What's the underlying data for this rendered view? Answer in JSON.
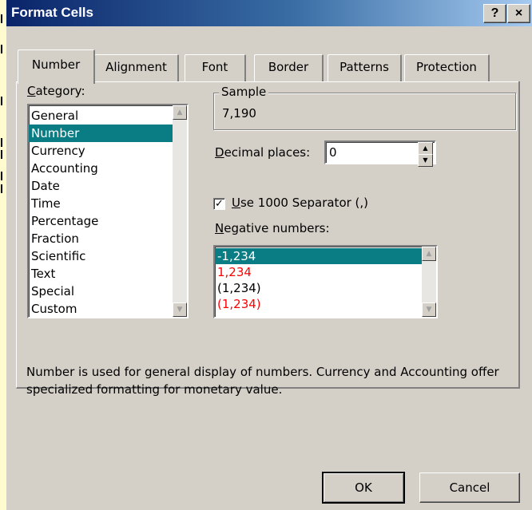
{
  "window": {
    "title": "Format Cells",
    "help_glyph": "?",
    "close_glyph": "×"
  },
  "tabs": [
    {
      "label": "Number",
      "active": true
    },
    {
      "label": "Alignment"
    },
    {
      "label": "Font"
    },
    {
      "label": "Border"
    },
    {
      "label": "Patterns"
    },
    {
      "label": "Protection"
    }
  ],
  "category": {
    "label_u": "C",
    "label_rest": "ategory:",
    "items": [
      "General",
      "Number",
      "Currency",
      "Accounting",
      "Date",
      "Time",
      "Percentage",
      "Fraction",
      "Scientific",
      "Text",
      "Special",
      "Custom"
    ],
    "selected": "Number"
  },
  "sample": {
    "title": "Sample",
    "value": "7,190"
  },
  "decimal_places": {
    "label_u": "D",
    "label_rest": "ecimal places:",
    "value": "0"
  },
  "separator": {
    "checked": true,
    "label_u": "U",
    "label_rest": "se 1000 Separator (,)"
  },
  "negative_numbers": {
    "label_u": "N",
    "label_rest": "egative numbers:",
    "items": [
      {
        "text": "-1,234",
        "color": "#000000",
        "selected": true
      },
      {
        "text": "1,234",
        "color": "#ff0000"
      },
      {
        "text": "(1,234)",
        "color": "#000000"
      },
      {
        "text": "(1,234)",
        "color": "#ff0000"
      }
    ]
  },
  "description": "Number is used for general display of numbers.  Currency and Accounting offer specialized formatting for monetary value.",
  "buttons": {
    "ok": "OK",
    "cancel": "Cancel"
  },
  "colors": {
    "selection": "#0a7c83",
    "negative_red": "#ff0000"
  }
}
